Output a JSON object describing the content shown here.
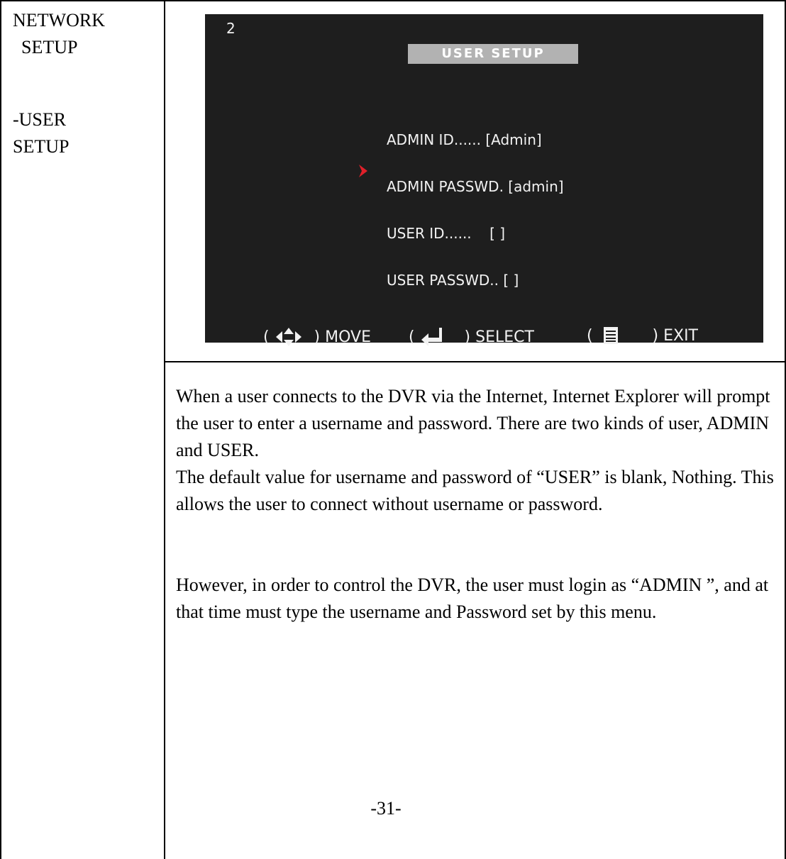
{
  "section": {
    "line1": "NETWORK",
    "line2": "SETUP",
    "sub1": "-USER",
    "sub2": "SETUP"
  },
  "screen": {
    "channel": "2",
    "title": "USER   SETUP",
    "items": [
      "ADMIN ID...... [Admin]",
      "ADMIN PASSWD. [admin]",
      "USER ID......    [ ]",
      "USER PASSWD.. [ ]"
    ],
    "footer": {
      "move": "MOVE",
      "select": "SELECT",
      "exit": "EXIT"
    },
    "colors": {
      "background": "#1e1e1e",
      "title_bar": "#b2b2b2",
      "cursor": "#e0202a"
    }
  },
  "description": {
    "paragraph1": "When a user connects to the DVR via the Internet, Internet Explorer will prompt the user to enter a username and password. There are two kinds of user, ADMIN and USER.",
    "paragraph2": "The default value for username and password of “USER” is blank, Nothing. This allows the user to connect without username or password.",
    "paragraph3": "However, in order to control the DVR, the user must login as “ADMIN ”, and at that time must type the username and Password set by this menu."
  },
  "page_number": "-31-"
}
